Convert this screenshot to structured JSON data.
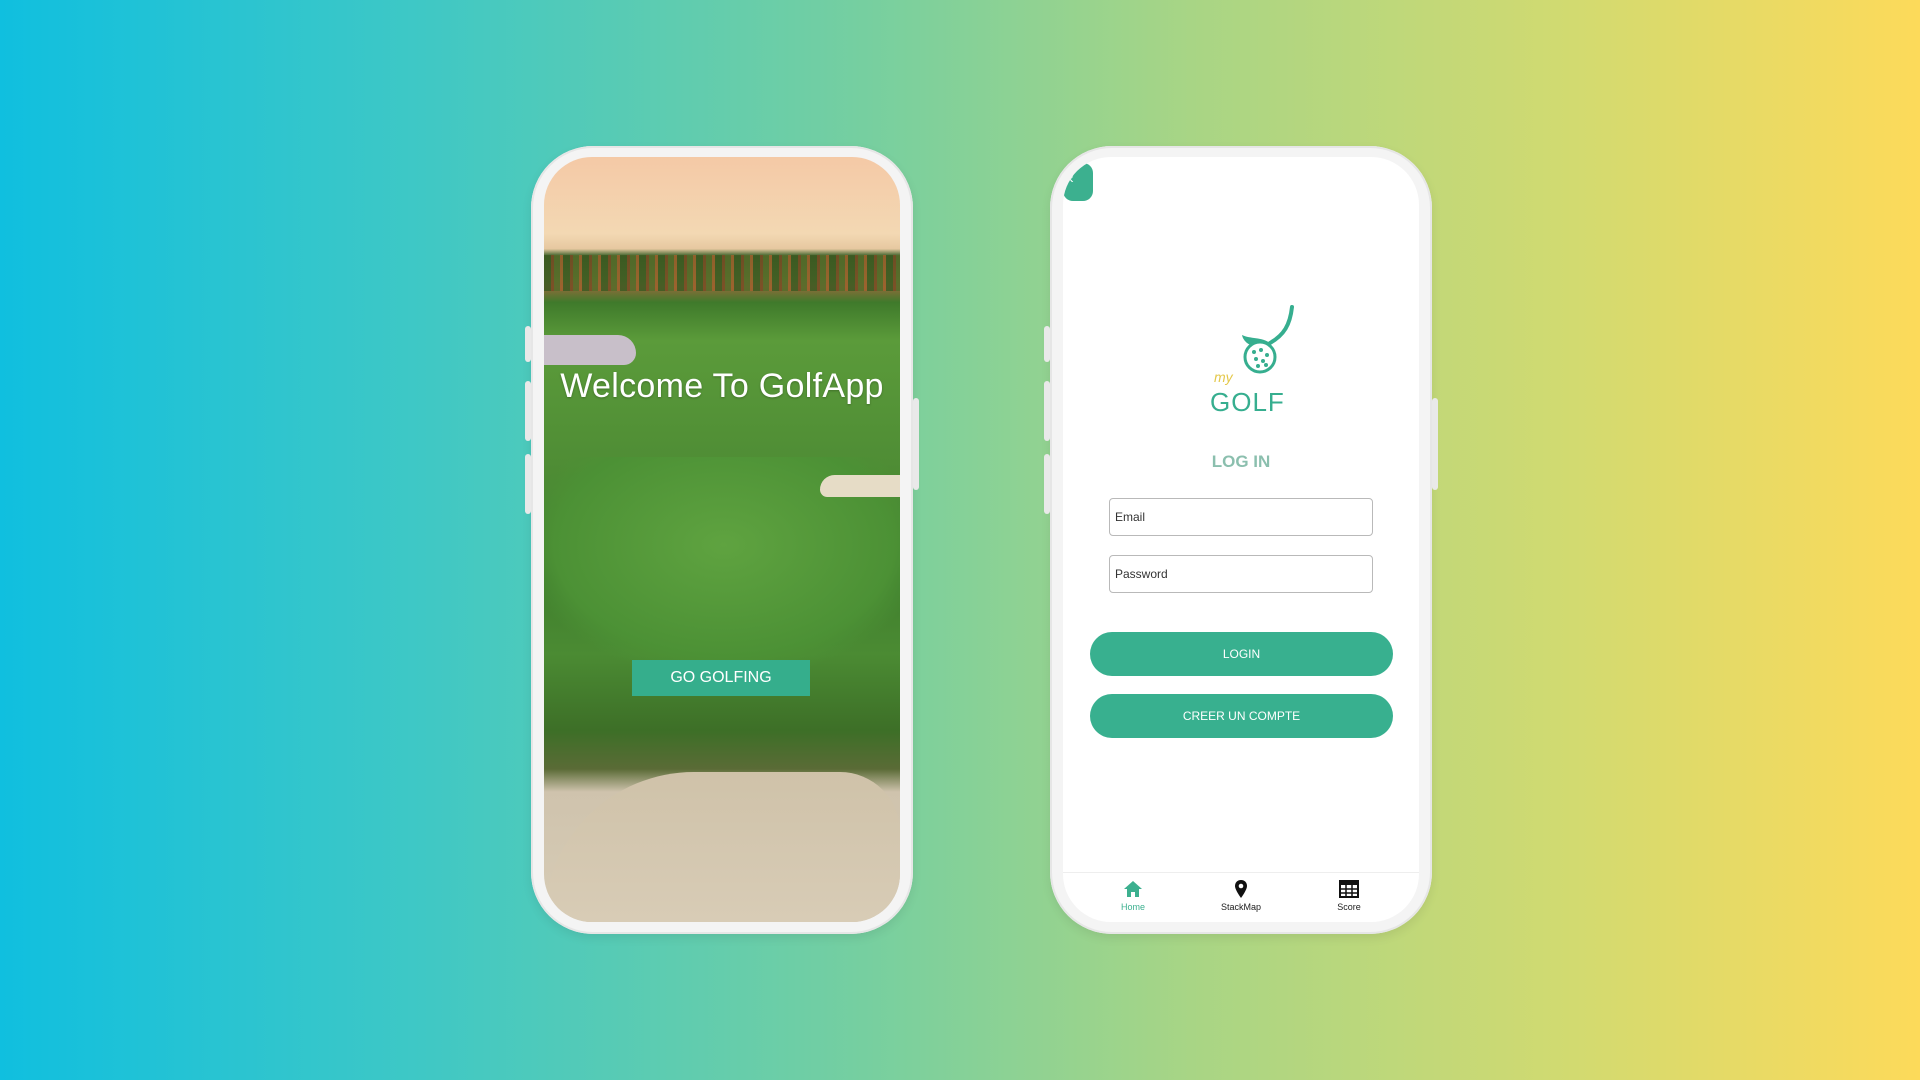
{
  "welcome": {
    "title": "Welcome To GolfApp",
    "cta_label": "GO GOLFING"
  },
  "login": {
    "logo": {
      "small_text": "my",
      "word": "GOLF"
    },
    "heading": "LOG IN",
    "email_placeholder": "Email",
    "password_placeholder": "Password",
    "login_label": "LOGIN",
    "create_account_label": "CREER UN COMPTE"
  },
  "tabbar": {
    "items": [
      {
        "label": "Home",
        "icon": "home-icon",
        "active": true
      },
      {
        "label": "StackMap",
        "icon": "map-pin-icon",
        "active": false
      },
      {
        "label": "Score",
        "icon": "grid-table-icon",
        "active": false
      }
    ]
  },
  "colors": {
    "accent": "#36ae8f",
    "logo_yellow": "#e4c84a",
    "background_left": "#10bfdf",
    "background_right": "#fdda5a"
  }
}
